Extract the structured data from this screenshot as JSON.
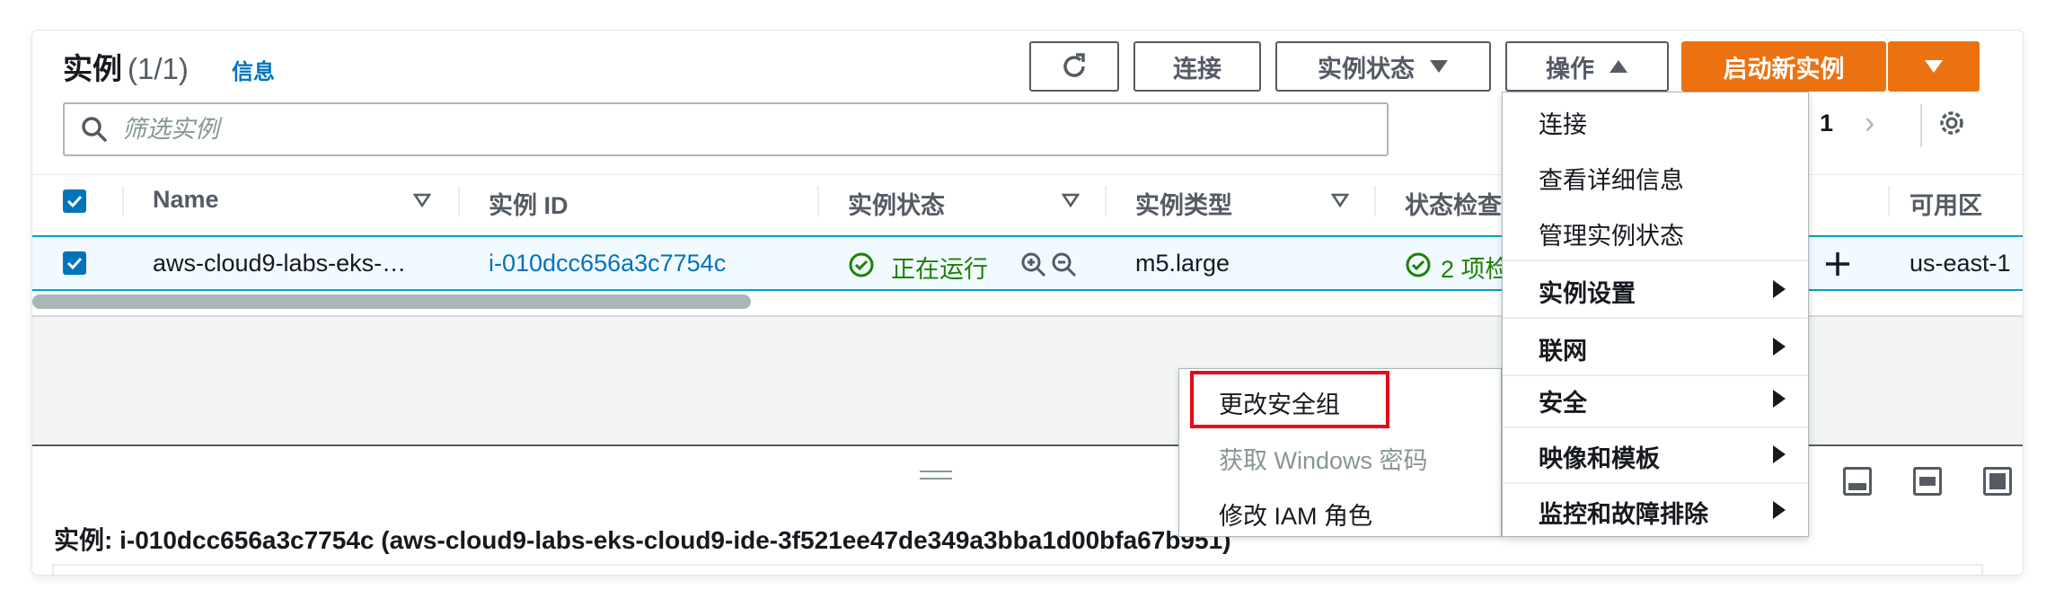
{
  "header": {
    "title": "实例",
    "count": "(1/1)",
    "info_link": "信息"
  },
  "toolbar": {
    "refresh_icon": "refresh-icon",
    "connect_label": "连接",
    "instance_state_label": "实例状态",
    "actions_label": "操作",
    "launch_label": "启动新实例"
  },
  "search": {
    "placeholder": "筛选实例",
    "icon": "search-icon"
  },
  "pagination": {
    "current_page": "1"
  },
  "table": {
    "columns": [
      "Name",
      "实例 ID",
      "实例状态",
      "实例类型",
      "状态检查",
      "可用区"
    ],
    "rows": [
      {
        "selected": true,
        "name": "aws-cloud9-labs-eks-…",
        "instance_id": "i-010dcc656a3c7754c",
        "state": "正在运行",
        "type": "m5.large",
        "status_check": "2 项检",
        "az": "us-east-1"
      }
    ]
  },
  "actions_menu": {
    "items": [
      {
        "label": "连接",
        "submenu": false
      },
      {
        "label": "查看详细信息",
        "submenu": false
      },
      {
        "label": "管理实例状态",
        "submenu": false
      },
      {
        "label": "实例设置",
        "submenu": true
      },
      {
        "label": "联网",
        "submenu": true
      },
      {
        "label": "安全",
        "submenu": true
      },
      {
        "label": "映像和模板",
        "submenu": true
      },
      {
        "label": "监控和故障排除",
        "submenu": true
      }
    ]
  },
  "security_submenu": {
    "items": [
      {
        "label": "更改安全组",
        "disabled": false,
        "highlighted": true
      },
      {
        "label": "获取 Windows 密码",
        "disabled": true
      },
      {
        "label": "修改 IAM 角色",
        "disabled": false
      }
    ]
  },
  "details": {
    "title": "实例: i-010dcc656a3c7754c (aws-cloud9-labs-eks-cloud9-ide-3f521ee47de349a3bba1d00bfa67b951)"
  },
  "colors": {
    "primary": "#ec7211",
    "link": "#0073bb",
    "success": "#1d8102",
    "highlight_box": "#e10b1a"
  }
}
